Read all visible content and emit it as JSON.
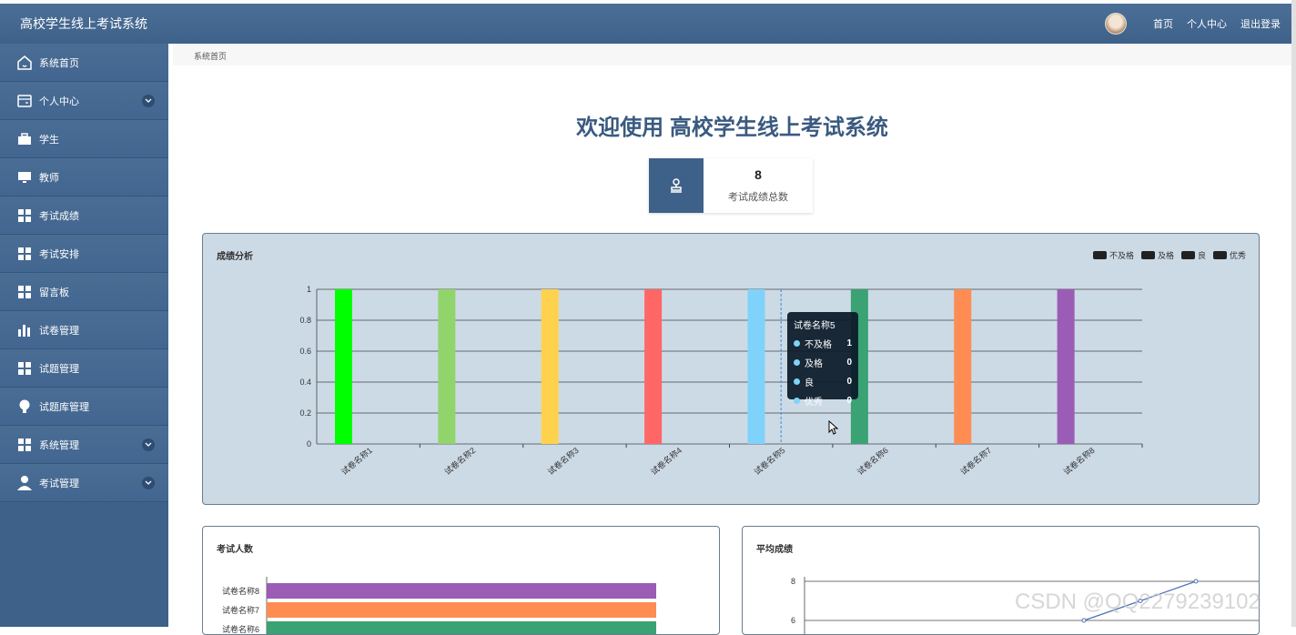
{
  "app": {
    "title": "高校学生线上考试系统"
  },
  "topnav": {
    "home": "首页",
    "profile": "个人中心",
    "logout": "退出登录"
  },
  "sidebar": {
    "items": [
      {
        "label": "系统首页",
        "icon": "home-icon",
        "expandable": false
      },
      {
        "label": "个人中心",
        "icon": "card-icon",
        "expandable": true
      },
      {
        "label": "学生",
        "icon": "briefcase-icon",
        "expandable": false
      },
      {
        "label": "教师",
        "icon": "monitor-icon",
        "expandable": false
      },
      {
        "label": "考试成绩",
        "icon": "grid-icon",
        "expandable": false
      },
      {
        "label": "考试安排",
        "icon": "grid-icon",
        "expandable": false
      },
      {
        "label": "留言板",
        "icon": "grid-icon",
        "expandable": false
      },
      {
        "label": "试卷管理",
        "icon": "bar-chart-icon",
        "expandable": false
      },
      {
        "label": "试题管理",
        "icon": "grid-icon",
        "expandable": false
      },
      {
        "label": "试题库管理",
        "icon": "bulb-icon",
        "expandable": false
      },
      {
        "label": "系统管理",
        "icon": "grid-icon",
        "expandable": true
      },
      {
        "label": "考试管理",
        "icon": "user-icon",
        "expandable": true
      }
    ]
  },
  "breadcrumb": "系统首页",
  "welcome": "欢迎使用 高校学生线上考试系统",
  "stat": {
    "value": "8",
    "label": "考试成绩总数"
  },
  "colors": {
    "accent": "#3e6189"
  },
  "chart_data": [
    {
      "type": "bar",
      "title": "成绩分析",
      "categories": [
        "试卷名称1",
        "试卷名称2",
        "试卷名称3",
        "试卷名称4",
        "试卷名称5",
        "试卷名称6",
        "试卷名称7",
        "试卷名称8"
      ],
      "bar_colors": [
        "#00ff00",
        "#91d46c",
        "#ffd24d",
        "#ff6666",
        "#7fd3fa",
        "#3aa273",
        "#ff8c52",
        "#9a5cb4"
      ],
      "legend": [
        "不及格",
        "及格",
        "良",
        "优秀"
      ],
      "series": [
        {
          "name": "不及格",
          "values": [
            1,
            1,
            1,
            1,
            1,
            1,
            1,
            1
          ]
        },
        {
          "name": "及格",
          "values": [
            0,
            0,
            0,
            0,
            0,
            0,
            0,
            0
          ]
        },
        {
          "name": "良",
          "values": [
            0,
            0,
            0,
            0,
            0,
            0,
            0,
            0
          ]
        },
        {
          "name": "优秀",
          "values": [
            0,
            0,
            0,
            0,
            0,
            0,
            0,
            0
          ]
        }
      ],
      "ylim": [
        0,
        1
      ],
      "yticks": [
        "0",
        "0.2",
        "0.4",
        "0.6",
        "0.8",
        "1"
      ],
      "tooltip": {
        "title": "试卷名称5",
        "rows": [
          {
            "label": "不及格",
            "value": "1"
          },
          {
            "label": "及格",
            "value": "0"
          },
          {
            "label": "良",
            "value": "0"
          },
          {
            "label": "优秀",
            "value": "0"
          }
        ]
      }
    },
    {
      "type": "bar",
      "title": "考试人数",
      "orientation": "horizontal",
      "categories": [
        "试卷名称8",
        "试卷名称7",
        "试卷名称6"
      ],
      "bar_colors": [
        "#9a5cb4",
        "#ff8c52",
        "#3aa273"
      ]
    },
    {
      "type": "line",
      "title": "平均成绩",
      "yticks": [
        "8",
        "6"
      ],
      "series": [
        {
          "values": [
            6,
            7,
            8
          ]
        }
      ]
    }
  ],
  "watermark": "CSDN @QQ2279239102"
}
